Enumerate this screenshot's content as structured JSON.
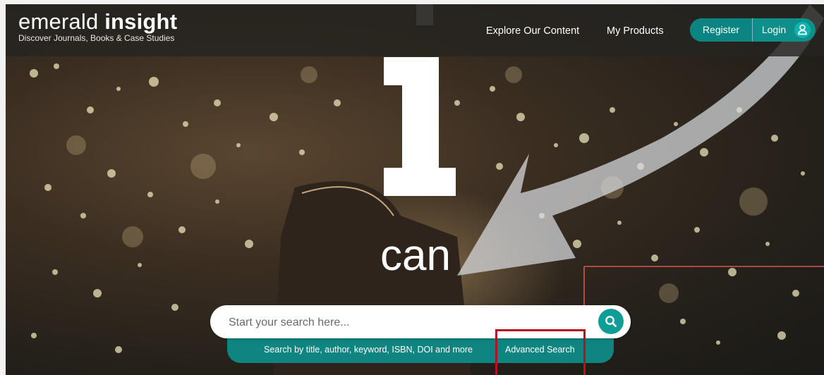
{
  "header": {
    "logo": {
      "light": "emerald ",
      "bold": "insight",
      "tagline": "Discover Journals, Books & Case Studies"
    },
    "nav": [
      {
        "label": "Explore Our Content"
      },
      {
        "label": "My Products"
      }
    ],
    "register_label": "Register",
    "login_label": "Login"
  },
  "hero": {
    "headline_top": "i",
    "headline_word": "can"
  },
  "search": {
    "placeholder": "Start your search here...",
    "hint": "Search by title, author, keyword, ISBN, DOI and more",
    "advanced_label": "Advanced Search"
  },
  "colors": {
    "accent_teal": "#0f8f8c",
    "highlight_red": "#b5121b"
  }
}
